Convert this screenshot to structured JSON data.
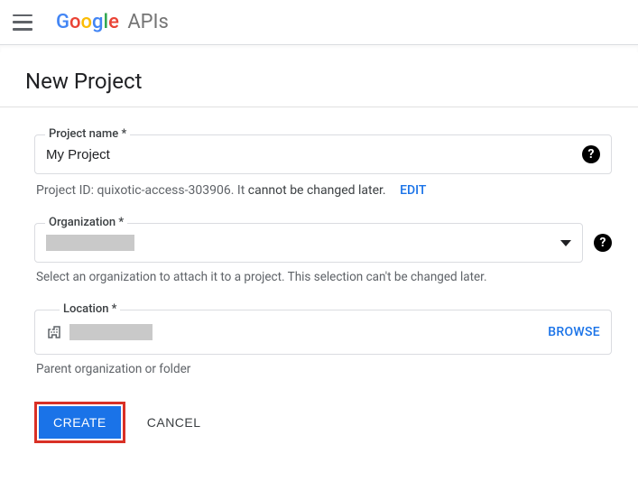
{
  "header": {
    "logo_text": "Google",
    "logo_suffix": "APIs"
  },
  "page": {
    "title": "New Project"
  },
  "form": {
    "project_name": {
      "label": "Project name *",
      "value": "My Project"
    },
    "project_id_line": {
      "prefix": "Project ID: ",
      "id": "quixotic-access-303906",
      "suffix": ". It ",
      "warn": "cannot be changed later.",
      "edit": "EDIT"
    },
    "organization": {
      "label": "Organization *",
      "helper": "Select an organization to attach it to a project. This selection can't be changed later."
    },
    "location": {
      "label": "Location *",
      "browse": "BROWSE",
      "helper": "Parent organization or folder"
    }
  },
  "actions": {
    "create": "CREATE",
    "cancel": "CANCEL"
  }
}
